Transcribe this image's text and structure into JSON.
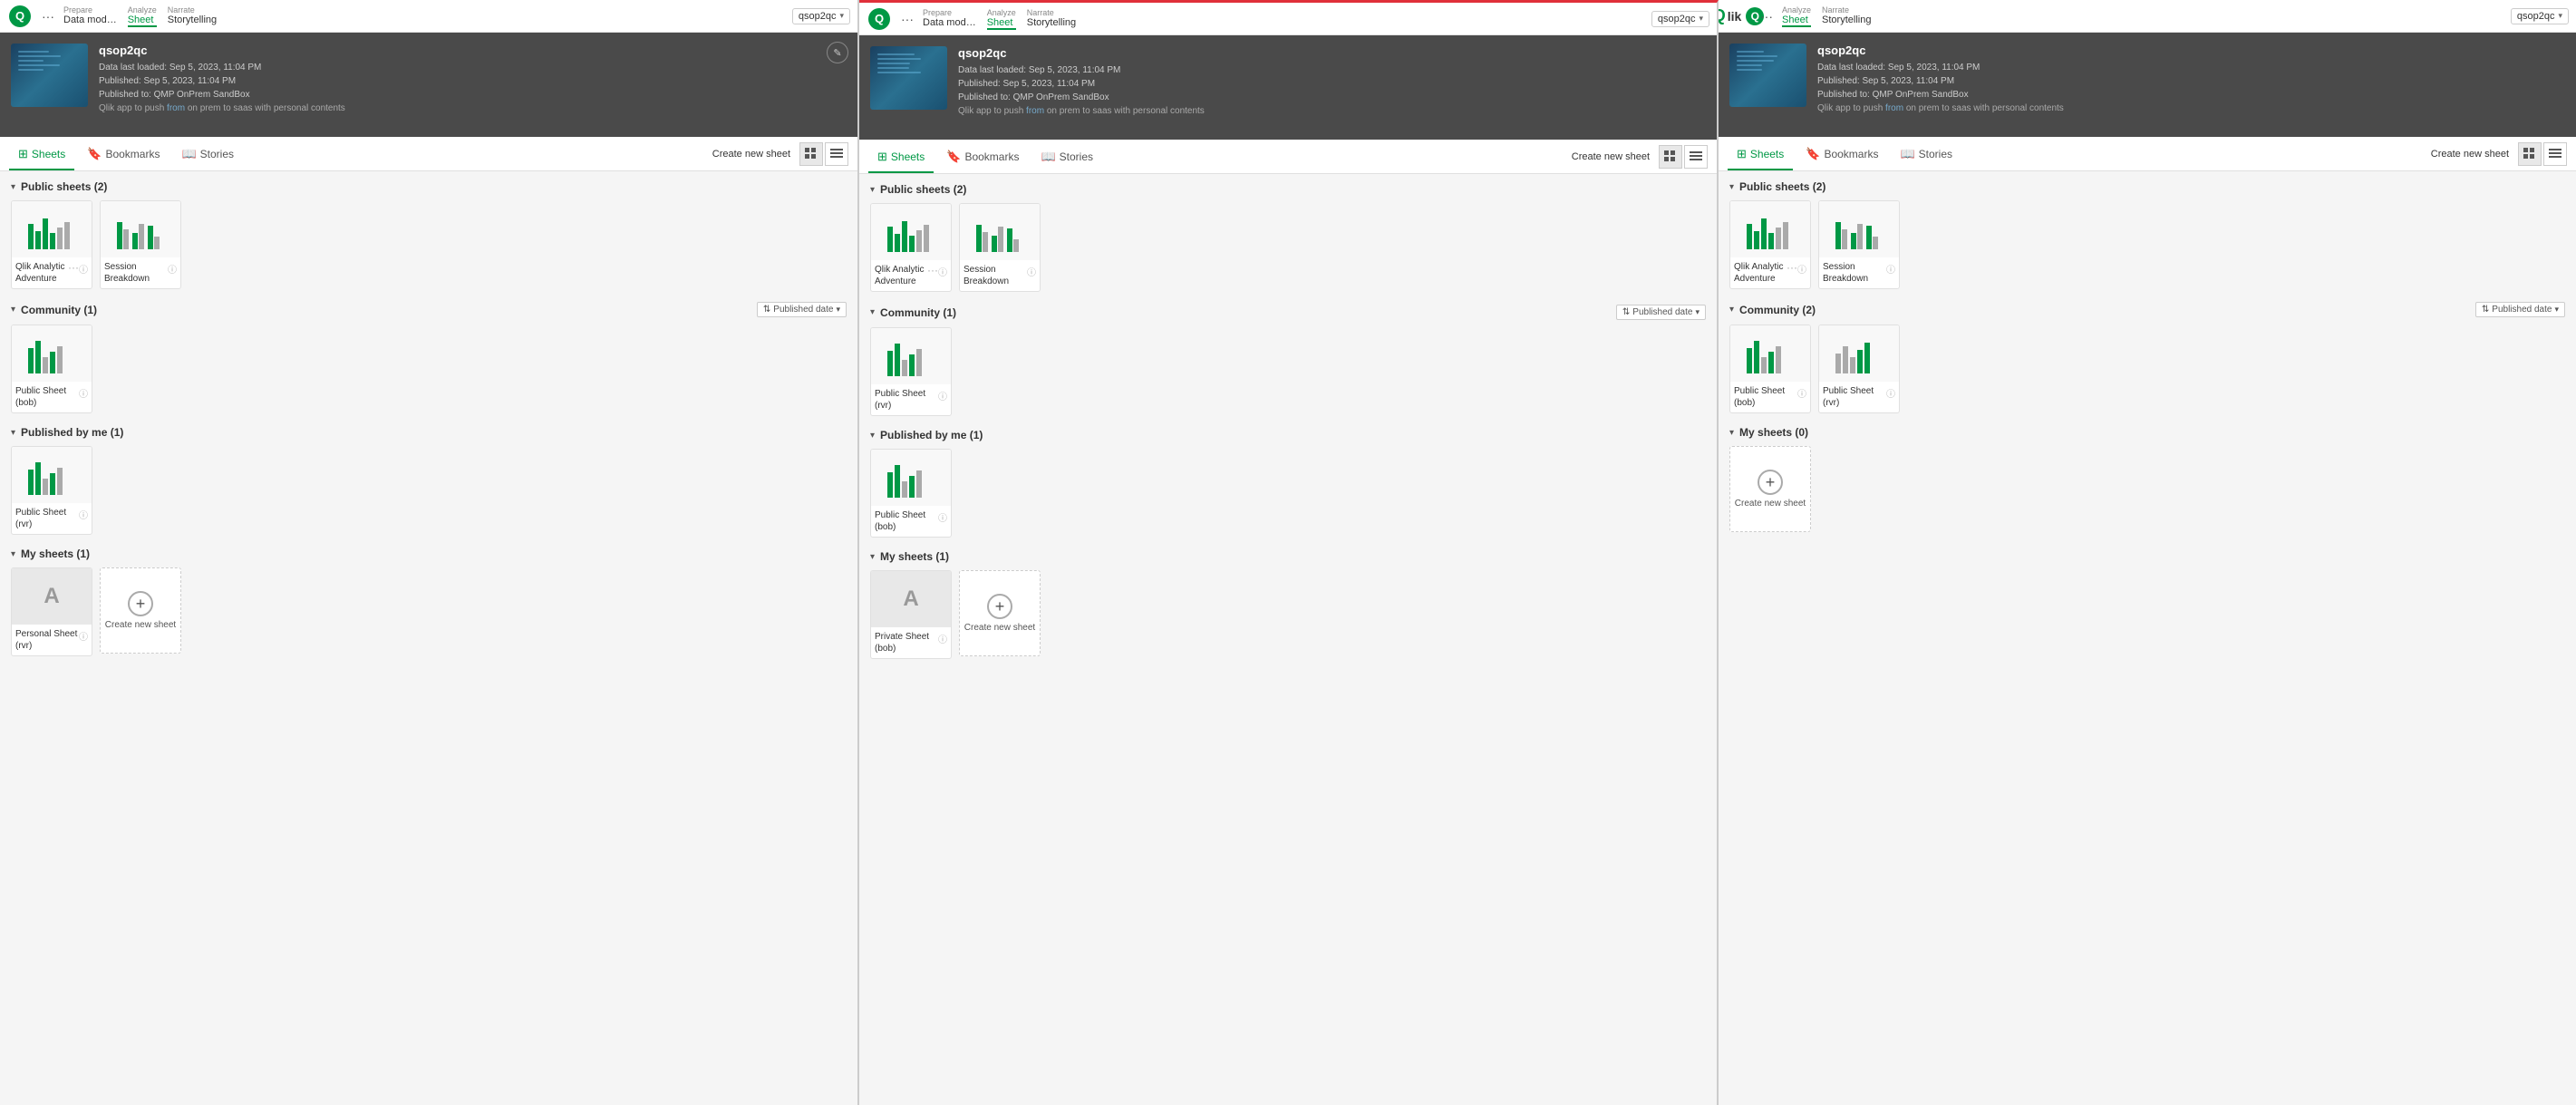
{
  "panels": [
    {
      "id": "panel-left",
      "class": "left",
      "topbar": {
        "logo": "qlik-logo",
        "dots": "···",
        "nav": [
          {
            "label": "Prepare",
            "value": "Data mod…",
            "active": false
          },
          {
            "label": "Analyze",
            "value": "Sheet",
            "active": true
          },
          {
            "label": "Narrate",
            "value": "Storytelling",
            "active": false
          }
        ],
        "app_selector": "qsop2qc"
      },
      "hero": {
        "app_name": "qsop2qc",
        "last_loaded": "Data last loaded: Sep 5, 2023, 11:04 PM",
        "published": "Published: Sep 5, 2023, 11:04 PM",
        "published_to": "Published to: QMP OnPrem SandBox",
        "desc": "Qlik app to push from on prem to saas with personal contents"
      },
      "tabs": {
        "items": [
          {
            "label": "Sheets",
            "active": true,
            "icon": "⊞"
          },
          {
            "label": "Bookmarks",
            "active": false,
            "icon": "🔖"
          },
          {
            "label": "Stories",
            "active": false,
            "icon": "📖"
          }
        ],
        "create_label": "Create new sheet"
      },
      "sections": [
        {
          "title": "Public sheets (2)",
          "show_sort": false,
          "sheets": [
            {
              "name": "Qlik Analytic Adventure",
              "type": "chart",
              "dots": true,
              "info": true
            },
            {
              "name": "Session Breakdown",
              "type": "chart2",
              "dots": false,
              "info": true
            }
          ]
        },
        {
          "title": "Community (1)",
          "show_sort": true,
          "sort_label": "Published date",
          "sheets": [
            {
              "name": "Public Sheet (bob)",
              "type": "chart3",
              "dots": false,
              "info": true
            }
          ]
        },
        {
          "title": "Published by me (1)",
          "show_sort": false,
          "sheets": [
            {
              "name": "Public Sheet (rvr)",
              "type": "chart3",
              "dots": false,
              "info": true
            }
          ]
        },
        {
          "title": "My sheets (1)",
          "show_sort": false,
          "sheets": [
            {
              "name": "Personal Sheet (rvr)",
              "type": "personal",
              "dots": false,
              "info": true
            },
            {
              "name": "Create new sheet",
              "type": "create"
            }
          ]
        }
      ]
    },
    {
      "id": "panel-middle",
      "class": "middle",
      "topbar": {
        "logo": "qlik-logo",
        "dots": "···",
        "nav": [
          {
            "label": "Prepare",
            "value": "Data mod…",
            "active": false
          },
          {
            "label": "Analyze",
            "value": "Sheet",
            "active": true
          },
          {
            "label": "Narrate",
            "value": "Storytelling",
            "active": false
          }
        ],
        "app_selector": "qsop2qc"
      },
      "hero": {
        "app_name": "qsop2qc",
        "last_loaded": "Data last loaded: Sep 5, 2023, 11:04 PM",
        "published": "Published: Sep 5, 2023, 11:04 PM",
        "published_to": "Published to: QMP OnPrem SandBox",
        "desc": "Qlik app to push from on prem to saas with personal contents"
      },
      "tabs": {
        "items": [
          {
            "label": "Sheets",
            "active": true,
            "icon": "⊞"
          },
          {
            "label": "Bookmarks",
            "active": false,
            "icon": "🔖"
          },
          {
            "label": "Stories",
            "active": false,
            "icon": "📖"
          }
        ],
        "create_label": "Create new sheet"
      },
      "sections": [
        {
          "title": "Public sheets (2)",
          "show_sort": false,
          "sheets": [
            {
              "name": "Qlik Analytic Adventure",
              "type": "chart",
              "dots": true,
              "info": true
            },
            {
              "name": "Session Breakdown",
              "type": "chart2",
              "dots": false,
              "info": true
            }
          ]
        },
        {
          "title": "Community (1)",
          "show_sort": true,
          "sort_label": "Published date",
          "sheets": [
            {
              "name": "Public Sheet (rvr)",
              "type": "chart3",
              "dots": false,
              "info": true
            }
          ]
        },
        {
          "title": "Published by me (1)",
          "show_sort": false,
          "sheets": [
            {
              "name": "Public Sheet (bob)",
              "type": "chart3",
              "dots": false,
              "info": true
            }
          ]
        },
        {
          "title": "My sheets (1)",
          "show_sort": false,
          "sheets": [
            {
              "name": "Private Sheet (bob)",
              "type": "personal",
              "dots": false,
              "info": true
            },
            {
              "name": "Create new sheet",
              "type": "create"
            }
          ]
        }
      ]
    },
    {
      "id": "panel-right",
      "class": "right",
      "topbar": {
        "logo": "qlik-logo",
        "dots": "···",
        "nav": [
          {
            "label": "Analyze",
            "value": "Sheet",
            "active": true
          },
          {
            "label": "Narrate",
            "value": "Storytelling",
            "active": false
          }
        ],
        "app_selector": "qsop2qc"
      },
      "hero": {
        "app_name": "qsop2qc",
        "last_loaded": "Data last loaded: Sep 5, 2023, 11:04 PM",
        "published": "Published: Sep 5, 2023, 11:04 PM",
        "published_to": "Published to: QMP OnPrem SandBox",
        "desc": "Qlik app to push from on prem to saas with personal contents"
      },
      "tabs": {
        "items": [
          {
            "label": "Sheets",
            "active": true,
            "icon": "⊞"
          },
          {
            "label": "Bookmarks",
            "active": false,
            "icon": "🔖"
          },
          {
            "label": "Stories",
            "active": false,
            "icon": "📖"
          }
        ],
        "create_label": "Create new sheet"
      },
      "sections": [
        {
          "title": "Public sheets (2)",
          "show_sort": false,
          "sheets": [
            {
              "name": "Qlik Analytic Adventure",
              "type": "chart",
              "dots": true,
              "info": true
            },
            {
              "name": "Session Breakdown",
              "type": "chart2",
              "dots": false,
              "info": true
            }
          ]
        },
        {
          "title": "Community (2)",
          "show_sort": true,
          "sort_label": "Published date",
          "sheets": [
            {
              "name": "Public Sheet (bob)",
              "type": "chart3",
              "dots": false,
              "info": true
            },
            {
              "name": "Public Sheet (rvr)",
              "type": "chart3b",
              "dots": false,
              "info": true
            }
          ]
        },
        {
          "title": "My sheets (0)",
          "show_sort": false,
          "sheets": [
            {
              "name": "Create new sheet",
              "type": "create"
            }
          ]
        }
      ]
    }
  ],
  "icons": {
    "grid": "⊞",
    "list": "≡",
    "chevron_down": "▾",
    "chevron_right": "▸",
    "info": "ⓘ",
    "edit": "✎",
    "add": "+"
  },
  "colors": {
    "accent": "#009845",
    "red": "#e0303a",
    "dark_bg": "#4a4a4a",
    "border": "#e0e0e0"
  }
}
